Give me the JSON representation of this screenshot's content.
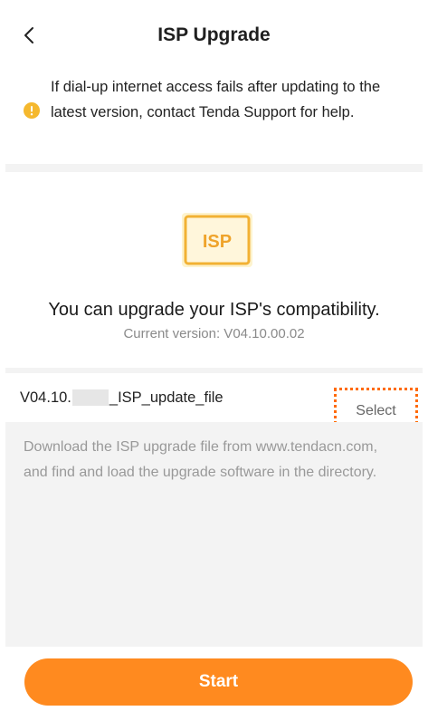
{
  "header": {
    "title": "ISP Upgrade",
    "back_icon": "chevron-left-icon"
  },
  "notice": {
    "icon": "warning-icon",
    "icon_color": "#F5B82E",
    "text": "If dial-up internet access fails after updating to the latest version, contact Tenda Support for help."
  },
  "info": {
    "badge_label": "ISP",
    "badge_color": "#F2B134",
    "headline": "You can upgrade your ISP's compatibility.",
    "current_version": "Current version: V04.10.00.02"
  },
  "file": {
    "name_prefix": "V04.10.",
    "name_suffix": "_ISP_update_file",
    "select_label": "Select",
    "highlight_color": "#FF6A00"
  },
  "help": {
    "text": "Download the ISP upgrade file from www.tendacn.com, and find and load the upgrade software in the directory."
  },
  "footer": {
    "start_label": "Start",
    "button_color": "#FF8A1F"
  }
}
